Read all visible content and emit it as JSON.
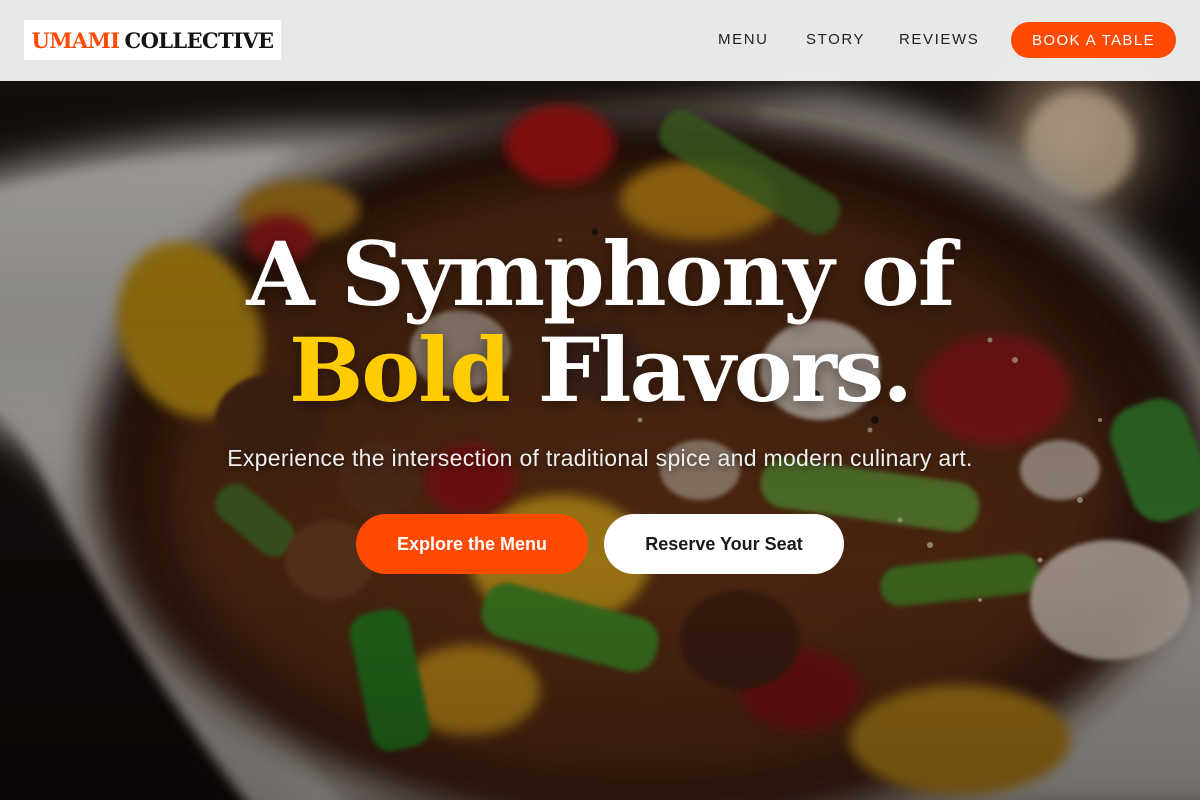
{
  "header": {
    "logo": {
      "accent_text": "UMAMI",
      "main_text": "COLLECTIVE"
    },
    "nav": {
      "menu": "MENU",
      "story": "STORY",
      "reviews": "REVIEWS"
    },
    "cta": "BOOK A TABLE"
  },
  "hero": {
    "title_line1": "A Symphony of",
    "title_highlight": "Bold",
    "title_line2_rest": "Flavors.",
    "subtitle": "Experience the intersection of traditional spice and modern culinary art.",
    "primary_button": "Explore the Menu",
    "secondary_button": "Reserve Your Seat",
    "image_subject": "stir-fry-dish-photo"
  },
  "colors": {
    "accent": "#ff4a05",
    "highlight": "#ffcc00",
    "header_bg": "#f1f1f1",
    "light_button": "#ffffff"
  }
}
